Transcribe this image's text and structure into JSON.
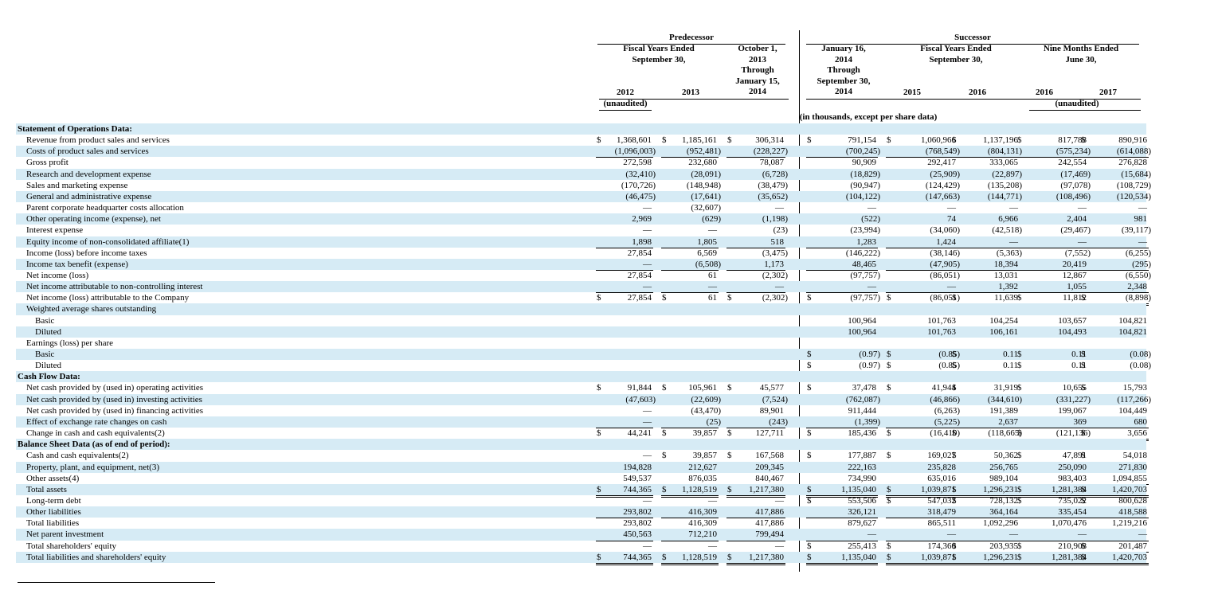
{
  "header": {
    "predecessor": "Predecessor",
    "successor": "Successor",
    "fye_pred": "Fiscal Years Ended\nSeptember 30,",
    "fye_succ": "Fiscal Years Ended\nSeptember 30,",
    "nine_months": "Nine Months Ended\nJune 30,",
    "c1": "2012",
    "c2": "2013",
    "c3": "October 1,\n2013\nThrough\nJanuary 15,\n2014",
    "c4": "January 16,\n2014\nThrough\nSeptember 30,\n2014",
    "c5": "2015",
    "c6": "2016",
    "c7": "2016",
    "c8": "2017",
    "unaudited1": "(unaudited)",
    "unaudited2": "(unaudited)",
    "units": "(in thousands, except per share data)"
  },
  "rows": [
    {
      "label": "Statement of Operations Data:",
      "type": "section",
      "vals": [
        "",
        "",
        "",
        "",
        "",
        "",
        "",
        ""
      ]
    },
    {
      "label": "Revenue from product sales and services",
      "vals": [
        "1,368,601",
        "1,185,161",
        "306,314",
        "791,154",
        "1,060,966",
        "1,137,196",
        "817,788",
        "890,916"
      ],
      "dollar": [
        1,
        1,
        1,
        1,
        1,
        1,
        1,
        1
      ]
    },
    {
      "label": "Costs of product sales and services",
      "vals": [
        "(1,096,003)",
        "(952,481)",
        "(228,227)",
        "(700,245)",
        "(768,549)",
        "(804,131)",
        "(575,234)",
        "(614,088)"
      ],
      "ul": 1
    },
    {
      "label": "Gross profit",
      "vals": [
        "272,598",
        "232,680",
        "78,087",
        "90,909",
        "292,417",
        "333,065",
        "242,554",
        "276,828"
      ]
    },
    {
      "label": "Research and development expense",
      "vals": [
        "(32,410)",
        "(28,091)",
        "(6,728)",
        "(18,829)",
        "(25,909)",
        "(22,897)",
        "(17,469)",
        "(15,684)"
      ]
    },
    {
      "label": "Sales and marketing expense",
      "vals": [
        "(170,726)",
        "(148,948)",
        "(38,479)",
        "(90,947)",
        "(124,429)",
        "(135,208)",
        "(97,078)",
        "(108,729)"
      ]
    },
    {
      "label": "General and administrative expense",
      "vals": [
        "(46,475)",
        "(17,641)",
        "(35,652)",
        "(104,122)",
        "(147,663)",
        "(144,771)",
        "(108,496)",
        "(120,534)"
      ]
    },
    {
      "label": "Parent corporate headquarter costs allocation",
      "vals": [
        "—",
        "(32,607)",
        "—",
        "—",
        "—",
        "—",
        "—",
        "—"
      ]
    },
    {
      "label": "Other operating income (expense), net",
      "vals": [
        "2,969",
        "(629)",
        "(1,198)",
        "(522)",
        "74",
        "6,966",
        "2,404",
        "981"
      ]
    },
    {
      "label": "Interest expense",
      "vals": [
        "—",
        "—",
        "(23)",
        "(23,994)",
        "(34,060)",
        "(42,518)",
        "(29,467)",
        "(39,117)"
      ]
    },
    {
      "label": "Equity income of non-consolidated affiliate(1)",
      "vals": [
        "1,898",
        "1,805",
        "518",
        "1,283",
        "1,424",
        "—",
        "—",
        "—"
      ],
      "ul": 1
    },
    {
      "label": "Income (loss) before income taxes",
      "vals": [
        "27,854",
        "6,569",
        "(3,475)",
        "(146,222)",
        "(38,146)",
        "(5,363)",
        "(7,552)",
        "(6,255)"
      ]
    },
    {
      "label": "Income tax benefit (expense)",
      "vals": [
        "—",
        "(6,508)",
        "1,173",
        "48,465",
        "(47,905)",
        "18,394",
        "20,419",
        "(295)"
      ],
      "ul": 1
    },
    {
      "label": "Net income (loss)",
      "vals": [
        "27,854",
        "61",
        "(2,302)",
        "(97,757)",
        "(86,051)",
        "13,031",
        "12,867",
        "(6,550)"
      ]
    },
    {
      "label": "Net income attributable to non-controlling interest",
      "vals": [
        "—",
        "—",
        "—",
        "—",
        "—",
        "1,392",
        "1,055",
        "2,348"
      ],
      "ul": 1
    },
    {
      "label": "Net income (loss) attributable to the Company",
      "vals": [
        "27,854",
        "61",
        "(2,302)",
        "(97,757)",
        "(86,051)",
        "11,639",
        "11,812",
        "(8,898)"
      ],
      "dollar": [
        1,
        1,
        1,
        1,
        1,
        1,
        1,
        1
      ],
      "dul": 1
    },
    {
      "label": "Weighted average shares outstanding",
      "vals": [
        "",
        "",
        "",
        "",
        "",
        "",
        "",
        ""
      ]
    },
    {
      "label": "Basic",
      "indent": 2,
      "vals": [
        "",
        "",
        "",
        "100,964",
        "101,763",
        "104,254",
        "103,657",
        "104,821"
      ]
    },
    {
      "label": "Diluted",
      "indent": 2,
      "vals": [
        "",
        "",
        "",
        "100,964",
        "101,763",
        "106,161",
        "104,493",
        "104,821"
      ]
    },
    {
      "label": "Earnings (loss) per share",
      "vals": [
        "",
        "",
        "",
        "",
        "",
        "",
        "",
        ""
      ]
    },
    {
      "label": "Basic",
      "indent": 2,
      "vals": [
        "",
        "",
        "",
        "(0.97)",
        "(0.85)",
        "0.11",
        "0.11",
        "(0.08)"
      ],
      "dollar": [
        0,
        0,
        0,
        1,
        1,
        1,
        1,
        1
      ]
    },
    {
      "label": "Diluted",
      "indent": 2,
      "vals": [
        "",
        "",
        "",
        "(0.97)",
        "(0.85)",
        "0.11",
        "0.11",
        "(0.08)"
      ],
      "dollar": [
        0,
        0,
        0,
        1,
        1,
        1,
        1,
        1
      ]
    },
    {
      "label": "Cash Flow Data:",
      "type": "section",
      "vals": [
        "",
        "",
        "",
        "",
        "",
        "",
        "",
        ""
      ]
    },
    {
      "label": "Net cash provided by (used in) operating activities",
      "vals": [
        "91,844",
        "105,961",
        "45,577",
        "37,478",
        "41,944",
        "31,919",
        "10,655",
        "15,793"
      ],
      "dollar": [
        1,
        1,
        1,
        1,
        1,
        1,
        1,
        1
      ]
    },
    {
      "label": "Net cash provided by (used in) investing activities",
      "vals": [
        "(47,603)",
        "(22,609)",
        "(7,524)",
        "(762,087)",
        "(46,866)",
        "(344,610)",
        "(331,227)",
        "(117,266)"
      ]
    },
    {
      "label": "Net cash provided by (used in) financing activities",
      "vals": [
        "—",
        "(43,470)",
        "89,901",
        "911,444",
        "(6,263)",
        "191,389",
        "199,067",
        "104,449"
      ]
    },
    {
      "label": "Effect of exchange rate changes on cash",
      "vals": [
        "—",
        "(25)",
        "(243)",
        "(1,399)",
        "(5,225)",
        "2,637",
        "369",
        "680"
      ],
      "ul": 1
    },
    {
      "label": "Change in cash and cash equivalents(2)",
      "vals": [
        "44,241",
        "39,857",
        "127,711",
        "185,436",
        "(16,410)",
        "(118,665)",
        "(121,136)",
        "3,656"
      ],
      "dollar": [
        1,
        1,
        1,
        1,
        1,
        1,
        1,
        1
      ],
      "dul": 1
    },
    {
      "label": "Balance Sheet Data (as of end of period):",
      "type": "section",
      "vals": [
        "",
        "",
        "",
        "",
        "",
        "",
        "",
        ""
      ]
    },
    {
      "label": "Cash and cash equivalents(2)",
      "vals": [
        "—",
        "39,857",
        "167,568",
        "177,887",
        "169,027",
        "50,362",
        "47,891",
        "54,018"
      ],
      "dollar": [
        0,
        1,
        1,
        1,
        1,
        1,
        1,
        1
      ]
    },
    {
      "label": "Property, plant, and equipment, net(3)",
      "vals": [
        "194,828",
        "212,627",
        "209,345",
        "222,163",
        "235,828",
        "256,765",
        "250,090",
        "271,830"
      ]
    },
    {
      "label": "Other assets(4)",
      "vals": [
        "549,537",
        "876,035",
        "840,467",
        "734,990",
        "635,016",
        "989,104",
        "983,403",
        "1,094,855"
      ],
      "ul": 1
    },
    {
      "label": "Total assets",
      "vals": [
        "744,365",
        "1,128,519",
        "1,217,380",
        "1,135,040",
        "1,039,871",
        "1,296,231",
        "1,281,384",
        "1,420,703"
      ],
      "dollar": [
        1,
        1,
        1,
        1,
        1,
        1,
        1,
        1
      ],
      "dul": 1
    },
    {
      "label": "Long-term debt",
      "vals": [
        "—",
        "—",
        "—",
        "553,506",
        "547,032",
        "728,132",
        "735,022",
        "800,628"
      ],
      "dollar": [
        0,
        0,
        0,
        1,
        1,
        1,
        1,
        1
      ]
    },
    {
      "label": "Other liabilities",
      "vals": [
        "293,802",
        "416,309",
        "417,886",
        "326,121",
        "318,479",
        "364,164",
        "335,454",
        "418,588"
      ],
      "ul": 1
    },
    {
      "label": "Total liabilities",
      "vals": [
        "293,802",
        "416,309",
        "417,886",
        "879,627",
        "865,511",
        "1,092,296",
        "1,070,476",
        "1,219,216"
      ]
    },
    {
      "label": "Net parent investment",
      "vals": [
        "450,563",
        "712,210",
        "799,494",
        "—",
        "—",
        "—",
        "—",
        "—"
      ],
      "ul": 1
    },
    {
      "label": "Total shareholders' equity",
      "vals": [
        "—",
        "—",
        "—",
        "255,413",
        "174,360",
        "203,935",
        "210,908",
        "201,487"
      ],
      "dollar": [
        0,
        0,
        0,
        1,
        1,
        1,
        1,
        1
      ],
      "ul": 1
    },
    {
      "label": "Total liabilities and shareholders' equity",
      "vals": [
        "744,365",
        "1,128,519",
        "1,217,380",
        "1,135,040",
        "1,039,871",
        "1,296,231",
        "1,281,384",
        "1,420,703"
      ],
      "dollar": [
        1,
        1,
        1,
        1,
        1,
        1,
        1,
        1
      ],
      "dul": 1
    }
  ],
  "dollar_sign": "$"
}
